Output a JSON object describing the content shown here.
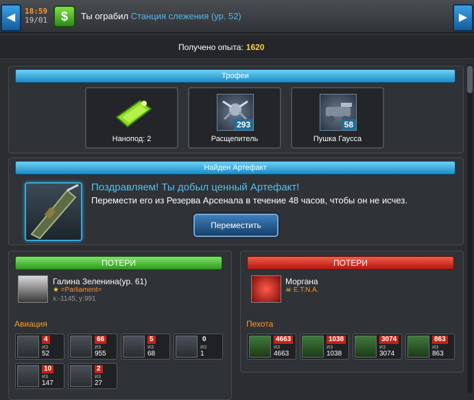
{
  "header": {
    "time": "18:59",
    "date": "19/01",
    "title_prefix": "Ты ограбил",
    "target": "Станция слежения (ур. 52)"
  },
  "experience": {
    "label": "Получено опыта:",
    "value": "1620"
  },
  "trophies": {
    "title": "Трофеи",
    "items": [
      {
        "label": "Нанопод: 2",
        "count": ""
      },
      {
        "label": "Расщепитель",
        "count": "293"
      },
      {
        "label": "Пушка Гаусса",
        "count": "58"
      }
    ]
  },
  "artifact": {
    "title": "Найден Артефакт",
    "headline": "Поздравляем! Ты добыл ценный Артефакт!",
    "description": "Перемести его из Резерва Арсенала в течение 48 часов, чтобы он не исчез.",
    "button": "Переместить"
  },
  "left_losses": {
    "title": "ПОТЕРИ",
    "player": "Галина Зеленина(ур. 61)",
    "alliance": "=Parliament=",
    "coords": "x:-1145; y:991",
    "section": "Авиация",
    "units": [
      {
        "lost": "4",
        "of": "из",
        "total": "52"
      },
      {
        "lost": "66",
        "of": "из",
        "total": "955"
      },
      {
        "lost": "5",
        "of": "из",
        "total": "68"
      },
      {
        "lost": "0",
        "of": "из",
        "total": "1"
      },
      {
        "lost": "10",
        "of": "из",
        "total": "147"
      },
      {
        "lost": "2",
        "of": "из",
        "total": "27"
      }
    ]
  },
  "right_losses": {
    "title": "ПОТЕРИ",
    "player": "Моргана",
    "alliance": "E.T.N.A.",
    "section": "Пехота",
    "units": [
      {
        "lost": "4663",
        "of": "из",
        "total": "4663"
      },
      {
        "lost": "1038",
        "of": "из",
        "total": "1038"
      },
      {
        "lost": "3074",
        "of": "из",
        "total": "3074"
      },
      {
        "lost": "863",
        "of": "из",
        "total": "863"
      }
    ]
  }
}
